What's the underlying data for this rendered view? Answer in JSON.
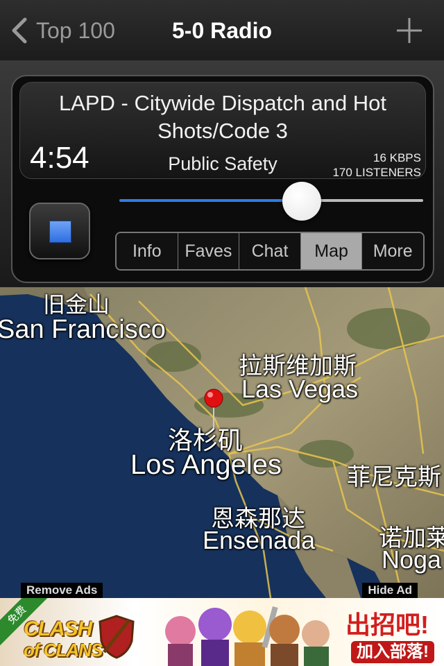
{
  "navbar": {
    "back_label": "Top 100",
    "title": "5-0 Radio"
  },
  "player": {
    "station_name": "LAPD - Citywide Dispatch and Hot Shots/Code 3",
    "elapsed": "4:54",
    "genre": "Public Safety",
    "bitrate": "16 KBPS",
    "listeners": "170 LISTENERS",
    "volume_fraction": 0.6,
    "tabs": [
      {
        "label": "Info",
        "active": false
      },
      {
        "label": "Faves",
        "active": false
      },
      {
        "label": "Chat",
        "active": false
      },
      {
        "label": "Map",
        "active": true
      },
      {
        "label": "More",
        "active": false
      }
    ]
  },
  "map": {
    "labels": {
      "sf_cn": "旧金山",
      "sf_en": "San Francisco",
      "lv_cn": "拉斯维加斯",
      "lv_en": "Las Vegas",
      "la_cn": "洛杉矶",
      "la_en": "Los Angeles",
      "phx_cn": "菲尼克斯",
      "ens_cn": "恩森那达",
      "ens_en": "Ensenada",
      "nog_cn": "诺加莱",
      "nog_en": "Noga"
    },
    "remove_ads": "Remove Ads",
    "hide_ad": "Hide Ad"
  },
  "ad": {
    "ribbon": "免费",
    "logo_line1": "CLASH",
    "logo_line2": "of CLANS",
    "headline": "出招吧!",
    "cta": "加入部落!"
  },
  "colors": {
    "accent_blue": "#2f7de8",
    "pin_red": "#e01010"
  }
}
